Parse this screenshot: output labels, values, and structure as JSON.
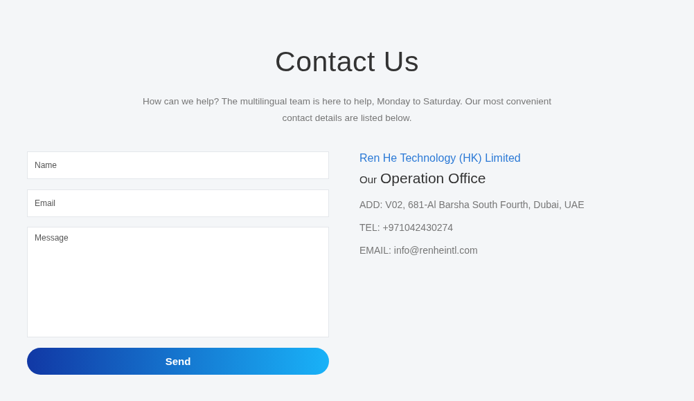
{
  "title": "Contact Us",
  "intro": "How can we help? The multilingual team is here to help, Monday to Saturday. Our most convenient contact details are listed below.",
  "form": {
    "fields": [
      {
        "kind": "line",
        "placeholder": "Name"
      },
      {
        "kind": "line",
        "placeholder": "Email"
      },
      {
        "kind": "area",
        "placeholder": "Message"
      }
    ],
    "submit": "Send"
  },
  "company": {
    "name": "Ren He Technology (HK) Limited",
    "office_prefix": "Our",
    "office_title": "Operation Office",
    "details": [
      "ADD: V02, 681-Al Barsha South Fourth, Dubai, UAE",
      "TEL: +971042430274",
      "EMAIL: info@renheintl.com"
    ]
  }
}
